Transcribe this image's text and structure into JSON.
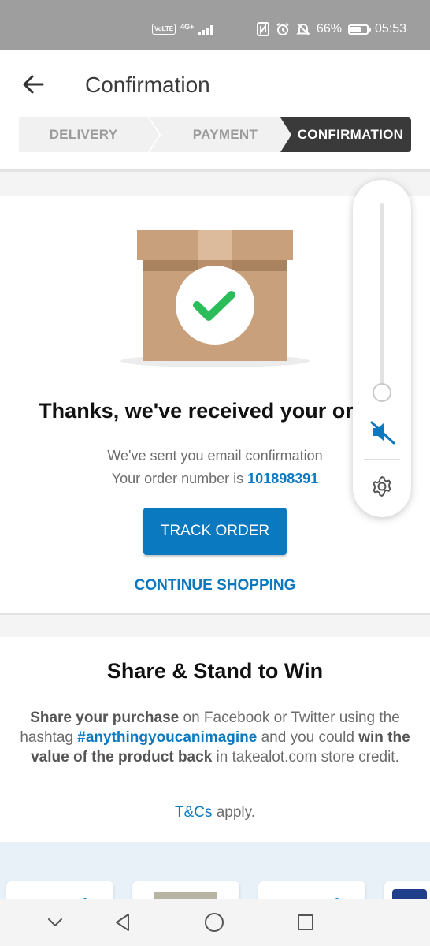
{
  "status_bar": {
    "volte": "VoLTE",
    "network": "4G+",
    "battery_text": "66%",
    "battery_level": 0.66,
    "time": "05:53"
  },
  "header": {
    "title": "Confirmation",
    "steps": [
      "DELIVERY",
      "PAYMENT",
      "CONFIRMATION"
    ],
    "active_step": "CONFIRMATION"
  },
  "confirmation": {
    "heading": "Thanks, we've received your order.",
    "email_line": "We've sent you email confirmation",
    "order_label": "Your order number is",
    "order_number": "101898391",
    "track_button": "TRACK ORDER",
    "continue_link": "CONTINUE SHOPPING"
  },
  "share": {
    "title": "Share & Stand to Win",
    "line_bold1": "Share your purchase",
    "line_text1": " on Facebook or Twitter using the hashtag ",
    "hashtag": "#anythingyoucanimagine",
    "line_text2": " and you could ",
    "line_bold2": "win the value of the product back",
    "line_text3": " in takealot.com store credit.",
    "tcs_link": "T&Cs",
    "tcs_text": " apply."
  },
  "volume_panel": {
    "level": 0.0,
    "muted": true
  },
  "colors": {
    "accent": "#0b79bf",
    "active_step_bg": "#3a3a3a",
    "success_green": "#2bbd5a",
    "box_brown": "#c8a07c"
  }
}
